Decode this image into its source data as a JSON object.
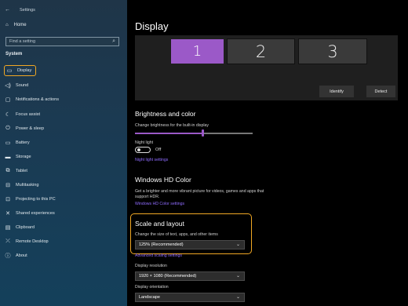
{
  "window": {
    "title": "Settings"
  },
  "sidebar": {
    "home_label": "Home",
    "search_placeholder": "Find a setting",
    "section": "System",
    "items": [
      {
        "label": "Display",
        "icon": "monitor-icon",
        "active": true
      },
      {
        "label": "Sound",
        "icon": "speaker-icon"
      },
      {
        "label": "Notifications & actions",
        "icon": "notifications-icon"
      },
      {
        "label": "Focus assist",
        "icon": "moon-icon"
      },
      {
        "label": "Power & sleep",
        "icon": "power-icon"
      },
      {
        "label": "Battery",
        "icon": "battery-icon"
      },
      {
        "label": "Storage",
        "icon": "storage-icon"
      },
      {
        "label": "Tablet",
        "icon": "tablet-icon"
      },
      {
        "label": "Multitasking",
        "icon": "multitasking-icon"
      },
      {
        "label": "Projecting to this PC",
        "icon": "projecting-icon"
      },
      {
        "label": "Shared experiences",
        "icon": "shared-experiences-icon"
      },
      {
        "label": "Clipboard",
        "icon": "clipboard-icon"
      },
      {
        "label": "Remote Desktop",
        "icon": "remote-desktop-icon"
      },
      {
        "label": "About",
        "icon": "info-icon"
      }
    ]
  },
  "main": {
    "title": "Display",
    "monitors": [
      "1",
      "2",
      "3"
    ],
    "identify_label": "Identify",
    "detect_label": "Detect",
    "brightness": {
      "heading": "Brightness and color",
      "slider_label": "Change brightness for the built-in display",
      "night_light_label": "Night light",
      "night_light_state": "Off",
      "night_light_link": "Night light settings"
    },
    "hdr": {
      "heading": "Windows HD Color",
      "description_line1": "Get a brighter and more vibrant picture for videos, games and apps that",
      "description_line2": "support HDR.",
      "link": "Windows HD Color settings"
    },
    "scale": {
      "heading": "Scale and layout",
      "size_label": "Change the size of text, apps, and other items",
      "size_value": "125% (Recommended)",
      "advanced_link": "Advanced scaling settings",
      "resolution_label": "Display resolution",
      "resolution_value": "1920 × 1080 (Recommended)",
      "orientation_label": "Display orientation",
      "orientation_value": "Landscape"
    }
  },
  "colors": {
    "accent": "#9b59c8",
    "highlight": "#f0a724",
    "link": "#8f6cff"
  }
}
